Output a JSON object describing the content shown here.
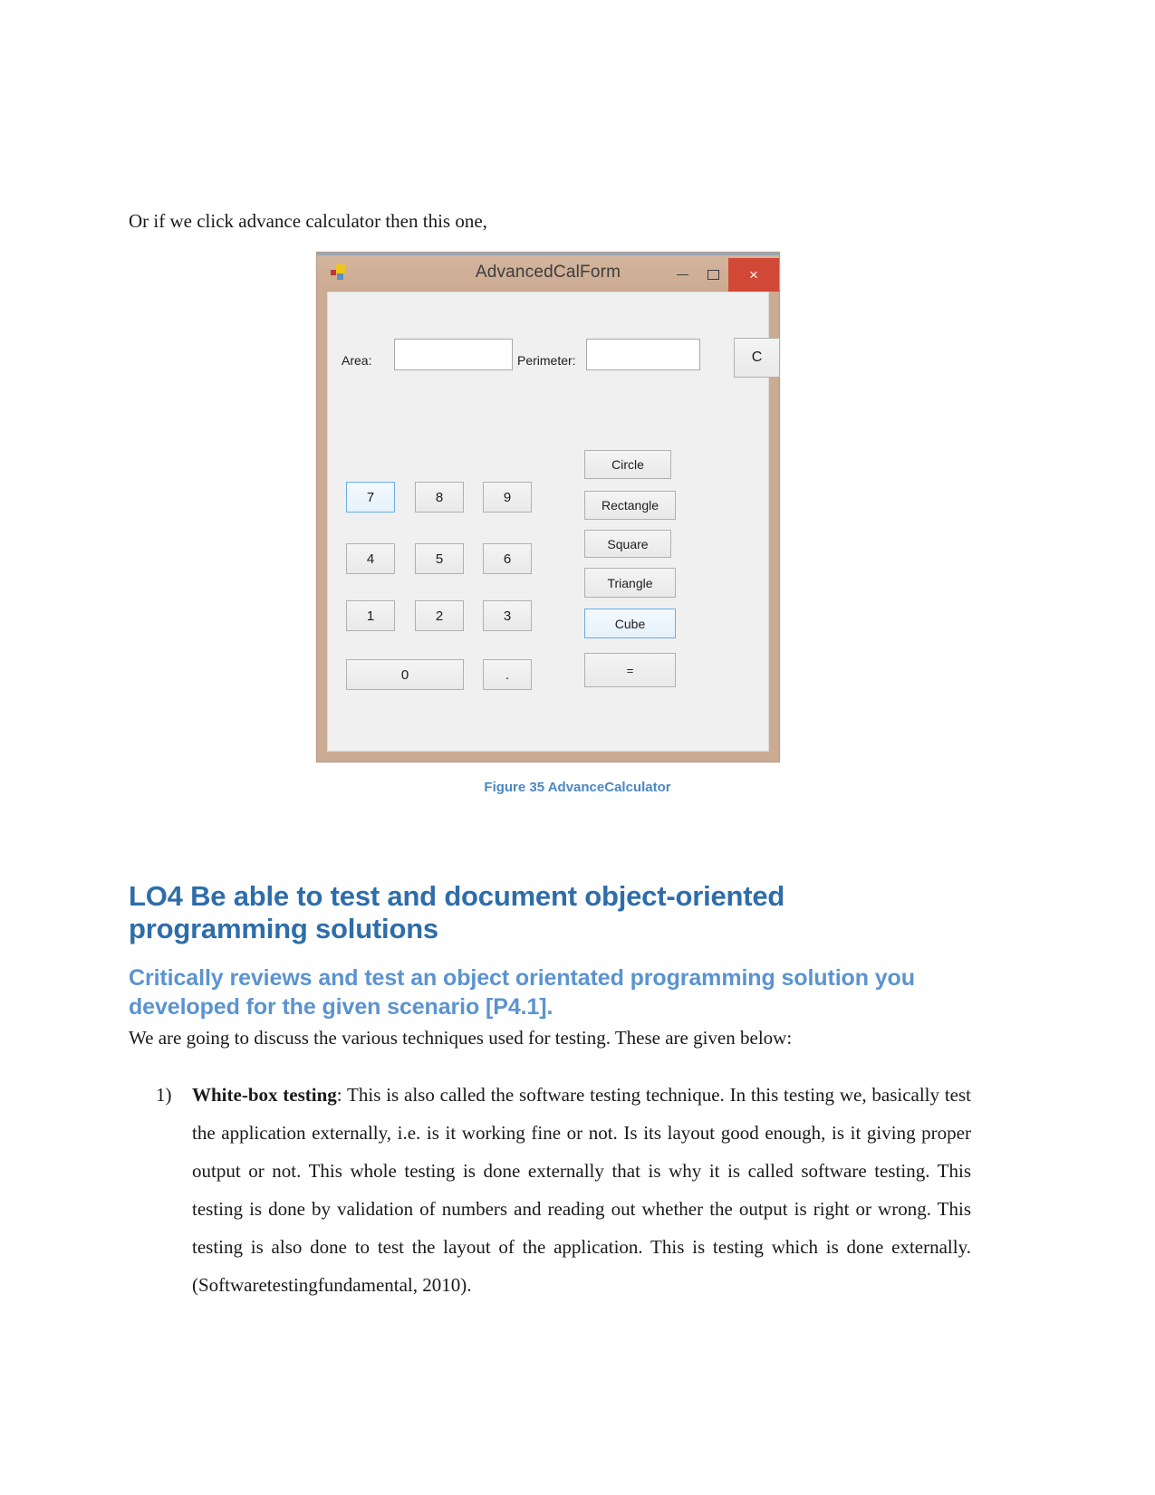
{
  "intro": {
    "line": "Or if we click advance calculator then this one,"
  },
  "winform": {
    "title": "AdvancedCalForm",
    "icon": "app-window-icon",
    "window_buttons": {
      "minimize": "minimize-icon",
      "maximize": "maximize-icon",
      "close": "×"
    },
    "labels": {
      "area": "Area:",
      "perimeter": "Perimeter:"
    },
    "inputs": {
      "area_value": "",
      "area_placeholder": "",
      "perimeter_value": "",
      "perimeter_placeholder": ""
    },
    "clear_button": "C",
    "numpad": [
      {
        "label": "7",
        "focused": true
      },
      {
        "label": "8",
        "focused": false
      },
      {
        "label": "9",
        "focused": false
      },
      {
        "label": "4",
        "focused": false
      },
      {
        "label": "5",
        "focused": false
      },
      {
        "label": "6",
        "focused": false
      },
      {
        "label": "1",
        "focused": false
      },
      {
        "label": "2",
        "focused": false
      },
      {
        "label": "3",
        "focused": false
      },
      {
        "label": "0",
        "focused": false
      },
      {
        "label": ".",
        "focused": false
      }
    ],
    "shapes": [
      {
        "label": "Circle",
        "focused": false
      },
      {
        "label": "Rectangle",
        "focused": false
      },
      {
        "label": "Square",
        "focused": false
      },
      {
        "label": "Triangle",
        "focused": false
      },
      {
        "label": "Cube",
        "focused": true
      }
    ],
    "equals_button": "=",
    "colors": {
      "titlebar": "#cbab92",
      "close_button": "#d14836",
      "focus_border": "#69aee8",
      "form_background": "#f0f0f0"
    }
  },
  "figure": {
    "caption": "Figure 35 AdvanceCalculator",
    "caption_color": "#4a87c4"
  },
  "headings": {
    "h1": "LO4 Be able to test and document object-oriented programming solutions",
    "h1_color": "#2e6daa",
    "h2": "Critically reviews and test an object orientated programming solution you developed for the given scenario [P4.1].",
    "h2_color": "#5b93d0"
  },
  "body": {
    "intro_paragraph": "We are going to discuss the various techniques used for testing. These are given below:",
    "list": [
      {
        "marker": "1)",
        "term": "White-box testing",
        "text": ": This is also called the software testing technique. In this testing we, basically test the application externally, i.e. is it working fine or not. Is its layout good enough, is it giving proper output or not. This whole testing is done externally that is why it is called software testing. This testing is done by validation of numbers and reading out whether the output is right or wrong. This testing is also done to test the layout of the application. This is testing which is done externally. (Softwaretestingfundamental, 2010)."
      }
    ]
  }
}
